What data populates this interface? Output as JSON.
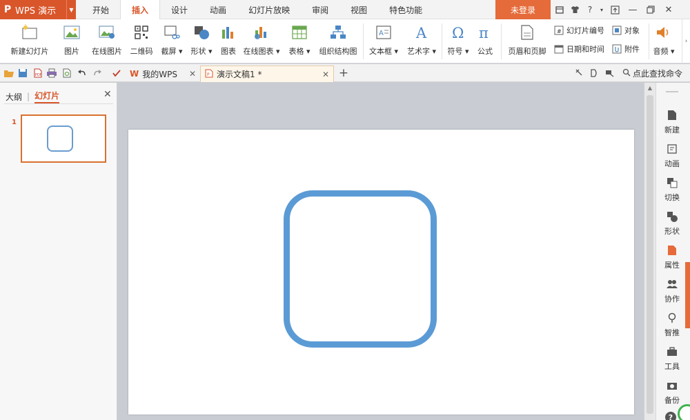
{
  "app": {
    "logo": "P",
    "name": "WPS 演示"
  },
  "menu": {
    "tabs": [
      "开始",
      "插入",
      "设计",
      "动画",
      "幻灯片放映",
      "审阅",
      "视图",
      "特色功能"
    ],
    "active": "插入",
    "login": "未登录",
    "help": "?"
  },
  "ribbon": {
    "new_slide": "新建幻灯片",
    "picture": "图片",
    "online_picture": "在线图片",
    "qrcode": "二维码",
    "screenshot": "截屏",
    "shape": "形状",
    "chart": "图表",
    "online_chart": "在线图表",
    "table": "表格",
    "org_chart": "组织结构图",
    "textbox": "文本框",
    "wordart": "艺术字",
    "symbol": "符号",
    "formula": "公式",
    "header_footer": "页眉和页脚",
    "slide_number": "幻灯片编号",
    "object": "对象",
    "date_time": "日期和时间",
    "attachment": "附件",
    "audio": "音频"
  },
  "doc_tabs": {
    "my_wps": "我的WPS",
    "document": "演示文稿1 *"
  },
  "search_command": "点此查找命令",
  "left_pane": {
    "outline": "大纲",
    "slides": "幻灯片",
    "slide_number": "1"
  },
  "right_pane": {
    "new": "新建",
    "animation": "动画",
    "transition": "切换",
    "shape": "形状",
    "properties": "属性",
    "collaborate": "协作",
    "smart": "智推",
    "tools": "工具",
    "backup": "备份"
  },
  "colors": {
    "brand": "#d9562b",
    "shape_stroke": "#5b9bd5",
    "thumb_border": "#d8702e"
  }
}
